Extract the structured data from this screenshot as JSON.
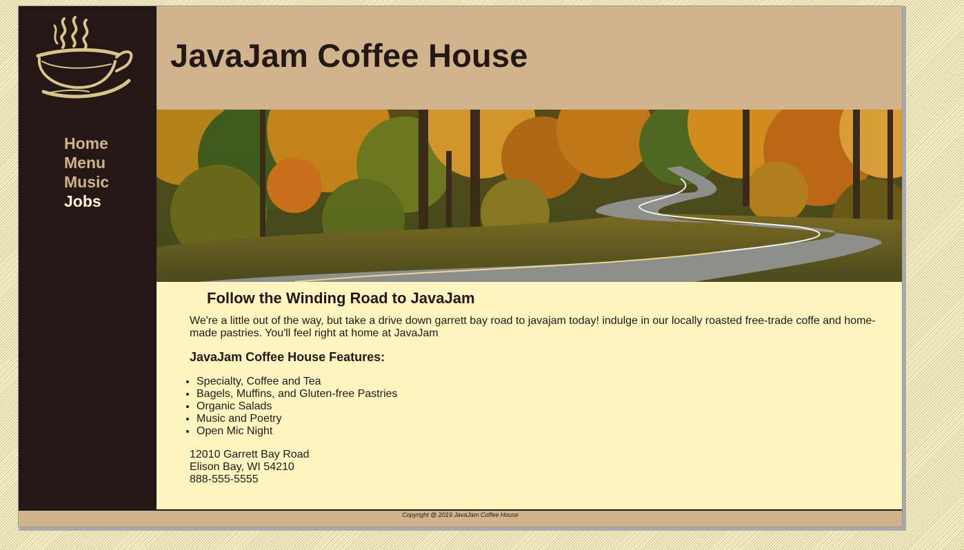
{
  "header": {
    "title": "JavaJam Coffee House"
  },
  "logo": {
    "icon": "coffee-cup-icon",
    "color": "#d9c48a"
  },
  "nav": {
    "items": [
      {
        "label": "Home",
        "current": false
      },
      {
        "label": "Menu",
        "current": false
      },
      {
        "label": "Music",
        "current": false
      },
      {
        "label": "Jobs",
        "current": true
      }
    ]
  },
  "hero": {
    "alt": "winding road through autumn forest"
  },
  "main": {
    "heading": "Follow the Winding Road to JavaJam",
    "intro": "We're a little out of the way, but take a drive down garrett bay road to javajam today! indulge in our locally roasted free-trade coffe and home-made pastries. You'll feel right at home at JavaJam",
    "features_heading": "JavaJam Coffee House Features:",
    "features": [
      "Specialty, Coffee and Tea",
      "Bagels, Muffins, and Gluten-free Pastries",
      "Organic Salads",
      "Music and Poetry",
      "Open Mic Night"
    ],
    "address": [
      "12010 Garrett Bay Road",
      "Elison Bay, WI 54210",
      "888-555-5555"
    ]
  },
  "footer": {
    "copyright": "Copyright @ 2019 JavaJam Coffee House"
  },
  "colors": {
    "sidebar": "#231815",
    "header": "#d2b48c",
    "content": "#fef5c0",
    "nav_link": "#d2b28c",
    "nav_current": "#fff6d8"
  }
}
